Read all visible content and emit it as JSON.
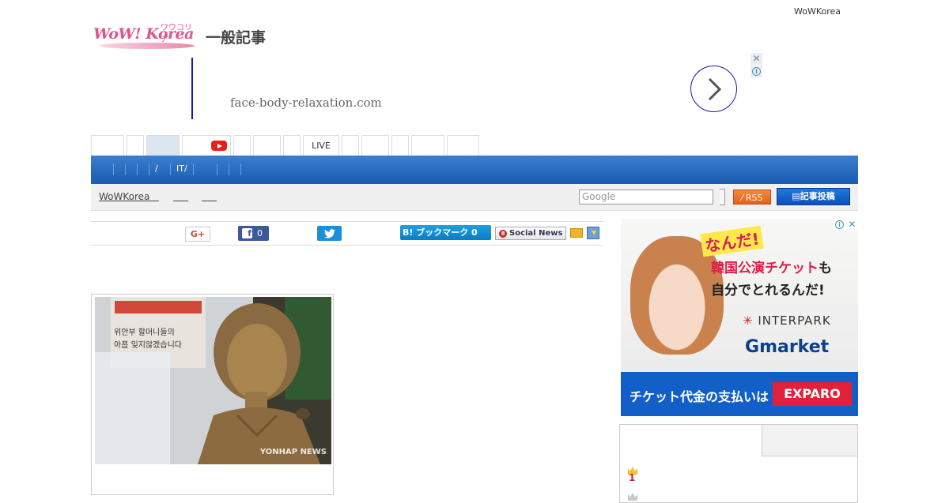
{
  "header": {
    "top_link": "WoWKorea",
    "logo_text": "WoW! Korea",
    "logo_kana": "ワウコリア",
    "section_title": "一般記事"
  },
  "ad_banner": {
    "domain": "face-body-relaxation.com",
    "close_glyph": "✕",
    "info_glyph": "i"
  },
  "tabs": {
    "live_label": "LIVE"
  },
  "nav": {
    "items": [
      "/",
      "IT/"
    ]
  },
  "breadcrumb": {
    "items": [
      "WoWKorea",
      "",
      ""
    ]
  },
  "search": {
    "placeholder": "Google"
  },
  "buttons": {
    "rss": "RSS",
    "post": "記事投稿"
  },
  "social": {
    "gplus": "G+",
    "fb_icon": "f",
    "fb_count": "0",
    "hatena": "B! ブックマーク 0",
    "socialnews": "Social News",
    "socialnews_dot": "8"
  },
  "article": {
    "photo_credit": "YONHAP NEWS"
  },
  "side_ad": {
    "headline": "なんだ!",
    "line1_red": "韓国公演チケット",
    "line1_black": "も",
    "line2": "自分でとれるんだ!",
    "interpark": "INTERPARK",
    "gmarket_g": "G",
    "gmarket_rest": "market",
    "footer_text": "チケット代金の支払いは",
    "exparo": "EXPARO",
    "info_glyph": "i",
    "close_glyph": "✕"
  },
  "ranking": {
    "first_num": "1"
  },
  "colors": {
    "brand_pink": "#e0548c",
    "nav_blue": "#1a5cb0",
    "ad_blue": "#1a1aa6",
    "youtube_red": "#e62117"
  }
}
